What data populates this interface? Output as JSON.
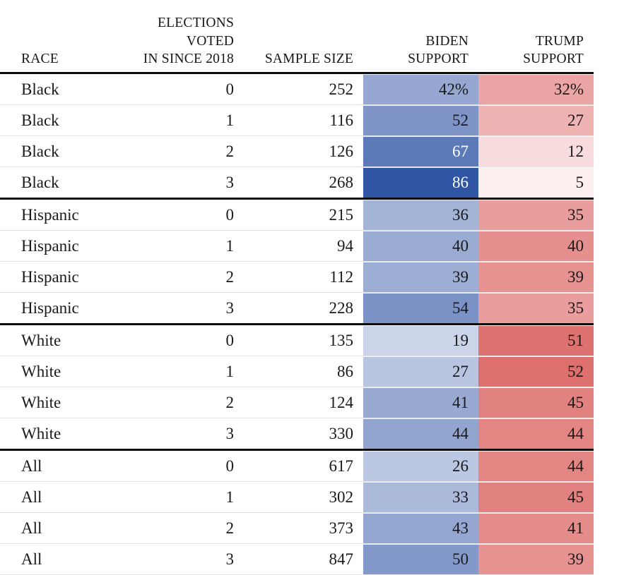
{
  "table": {
    "columns": [
      {
        "key": "race",
        "label": "RACE",
        "align": "left"
      },
      {
        "key": "elections",
        "label": "ELECTIONS VOTED\nIN SINCE 2018",
        "align": "right"
      },
      {
        "key": "sample",
        "label": "SAMPLE SIZE",
        "align": "right"
      },
      {
        "key": "biden",
        "label": "BIDEN SUPPORT",
        "align": "right"
      },
      {
        "key": "trump",
        "label": "TRUMP SUPPORT",
        "align": "right"
      }
    ],
    "rows": [
      {
        "race": "Black",
        "elections": "0",
        "sample": "252",
        "biden": "42%",
        "trump": "32%",
        "biden_value": 42,
        "trump_value": 32,
        "group_start": true
      },
      {
        "race": "Black",
        "elections": "1",
        "sample": "116",
        "biden": "52",
        "trump": "27",
        "biden_value": 52,
        "trump_value": 27,
        "group_start": false
      },
      {
        "race": "Black",
        "elections": "2",
        "sample": "126",
        "biden": "67",
        "trump": "12",
        "biden_value": 67,
        "trump_value": 12,
        "group_start": false
      },
      {
        "race": "Black",
        "elections": "3",
        "sample": "268",
        "biden": "86",
        "trump": "5",
        "biden_value": 86,
        "trump_value": 5,
        "group_start": false
      },
      {
        "race": "Hispanic",
        "elections": "0",
        "sample": "215",
        "biden": "36",
        "trump": "35",
        "biden_value": 36,
        "trump_value": 35,
        "group_start": true
      },
      {
        "race": "Hispanic",
        "elections": "1",
        "sample": "94",
        "biden": "40",
        "trump": "40",
        "biden_value": 40,
        "trump_value": 40,
        "group_start": false
      },
      {
        "race": "Hispanic",
        "elections": "2",
        "sample": "112",
        "biden": "39",
        "trump": "39",
        "biden_value": 39,
        "trump_value": 39,
        "group_start": false
      },
      {
        "race": "Hispanic",
        "elections": "3",
        "sample": "228",
        "biden": "54",
        "trump": "35",
        "biden_value": 54,
        "trump_value": 35,
        "group_start": false
      },
      {
        "race": "White",
        "elections": "0",
        "sample": "135",
        "biden": "19",
        "trump": "51",
        "biden_value": 19,
        "trump_value": 51,
        "group_start": true
      },
      {
        "race": "White",
        "elections": "1",
        "sample": "86",
        "biden": "27",
        "trump": "52",
        "biden_value": 27,
        "trump_value": 52,
        "group_start": false
      },
      {
        "race": "White",
        "elections": "2",
        "sample": "124",
        "biden": "41",
        "trump": "45",
        "biden_value": 41,
        "trump_value": 45,
        "group_start": false
      },
      {
        "race": "White",
        "elections": "3",
        "sample": "330",
        "biden": "44",
        "trump": "44",
        "biden_value": 44,
        "trump_value": 44,
        "group_start": false
      },
      {
        "race": "All",
        "elections": "0",
        "sample": "617",
        "biden": "26",
        "trump": "44",
        "biden_value": 26,
        "trump_value": 44,
        "group_start": true
      },
      {
        "race": "All",
        "elections": "1",
        "sample": "302",
        "biden": "33",
        "trump": "45",
        "biden_value": 33,
        "trump_value": 45,
        "group_start": false
      },
      {
        "race": "All",
        "elections": "2",
        "sample": "373",
        "biden": "43",
        "trump": "41",
        "biden_value": 43,
        "trump_value": 41,
        "group_start": false
      },
      {
        "race": "All",
        "elections": "3",
        "sample": "847",
        "biden": "50",
        "trump": "39",
        "biden_value": 50,
        "trump_value": 39,
        "group_start": false
      }
    ]
  },
  "colors": {
    "biden_min": "#ccd4e9",
    "biden_max": "#2f55a4",
    "trump_min": "#fdeeef",
    "trump_max": "#dd6f6d",
    "rule": "#0d0d0d",
    "row_line": "#e3e3e3",
    "text": "#1a1a1a",
    "light_text": "#ffffff"
  },
  "scales": {
    "biden_domain": [
      19,
      86
    ],
    "trump_domain": [
      5,
      52
    ],
    "light_text_threshold": 60
  },
  "chart_data": {
    "type": "heatmap",
    "title": "",
    "xlabel": "",
    "ylabel": "",
    "row_keys": [
      "race",
      "elections_voted_in_since_2018",
      "sample_size"
    ],
    "value_columns": [
      "biden_support",
      "trump_support"
    ],
    "units": "percent",
    "legend": "none",
    "grid": false,
    "colormaps": {
      "biden_support": {
        "low": "#ccd4e9",
        "high": "#2f55a4",
        "domain": [
          19,
          86
        ]
      },
      "trump_support": {
        "low": "#fdeeef",
        "high": "#dd6f6d",
        "domain": [
          5,
          52
        ]
      }
    },
    "categories": [
      "Black 0",
      "Black 1",
      "Black 2",
      "Black 3",
      "Hispanic 0",
      "Hispanic 1",
      "Hispanic 2",
      "Hispanic 3",
      "White 0",
      "White 1",
      "White 2",
      "White 3",
      "All 0",
      "All 1",
      "All 2",
      "All 3"
    ],
    "series": [
      {
        "name": "Biden support",
        "values": [
          42,
          52,
          67,
          86,
          36,
          40,
          39,
          54,
          19,
          27,
          41,
          44,
          26,
          33,
          43,
          50
        ]
      },
      {
        "name": "Trump support",
        "values": [
          32,
          27,
          12,
          5,
          35,
          40,
          39,
          35,
          51,
          52,
          45,
          44,
          44,
          45,
          41,
          39
        ]
      },
      {
        "name": "Sample size",
        "values": [
          252,
          116,
          126,
          268,
          215,
          94,
          112,
          228,
          135,
          86,
          124,
          330,
          617,
          302,
          373,
          847
        ]
      }
    ],
    "groups": [
      {
        "name": "Black",
        "rows": [
          0,
          1,
          2,
          3
        ]
      },
      {
        "name": "Hispanic",
        "rows": [
          4,
          5,
          6,
          7
        ]
      },
      {
        "name": "White",
        "rows": [
          8,
          9,
          10,
          11
        ]
      },
      {
        "name": "All",
        "rows": [
          12,
          13,
          14,
          15
        ]
      }
    ]
  }
}
